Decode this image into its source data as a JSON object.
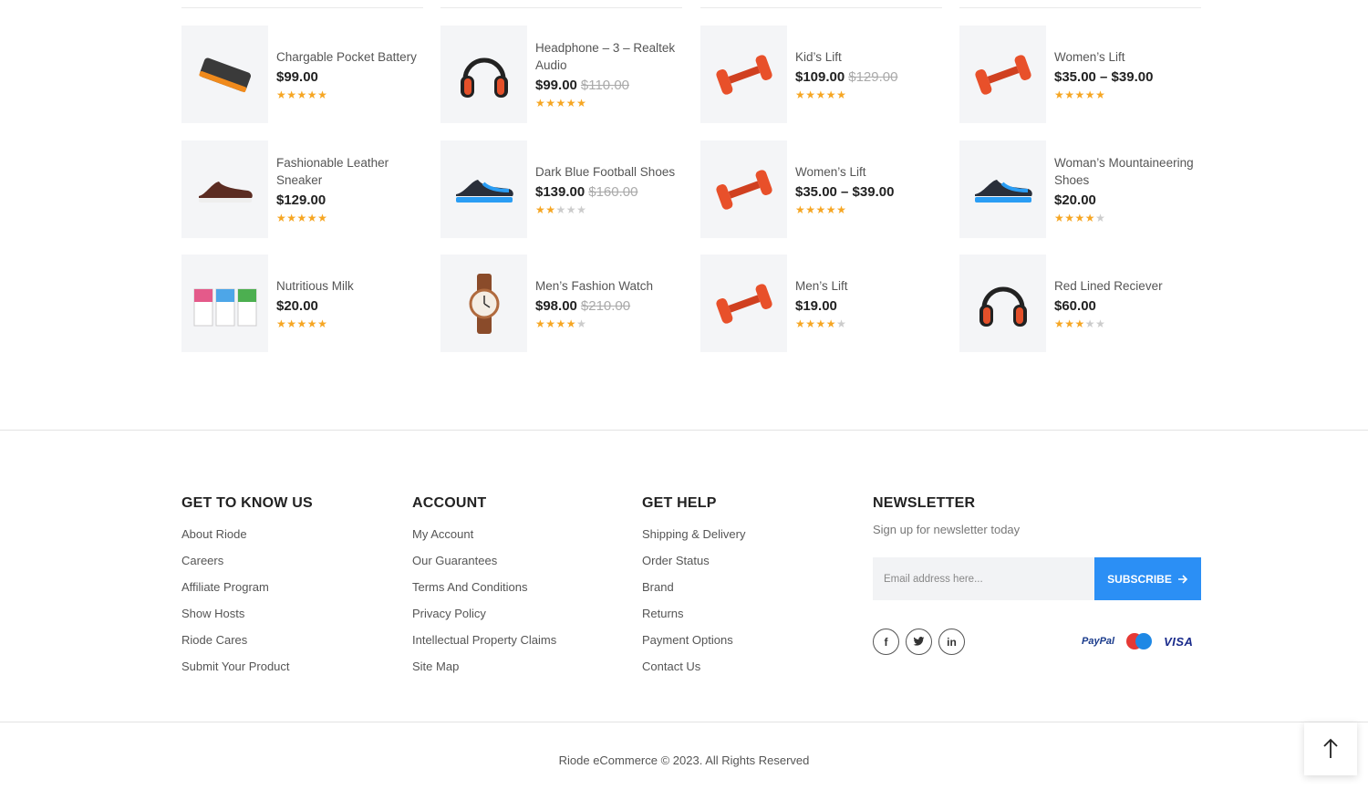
{
  "products": [
    {
      "name": "Chargable Pocket Battery",
      "price": "$99.00",
      "old_price": "",
      "rating": 5,
      "icon": "battery-pack-image"
    },
    {
      "name": "Headphone – 3 – Realtek Audio",
      "price": "$99.00",
      "old_price": "$110.00",
      "rating": 4.5,
      "icon": "headphones-image"
    },
    {
      "name": "Kid’s Lift",
      "price": "$109.00",
      "old_price": "$129.00",
      "rating": 4.5,
      "icon": "dumbbell-image"
    },
    {
      "name": "Women’s Lift",
      "price": "$35.00 – $39.00",
      "old_price": "",
      "rating": 5,
      "icon": "dumbbell-image"
    },
    {
      "name": "Fashionable Leather Sneaker",
      "price": "$129.00",
      "old_price": "",
      "rating": 5,
      "icon": "sneaker-image"
    },
    {
      "name": "Dark Blue Football Shoes",
      "price": "$139.00",
      "old_price": "$160.00",
      "rating": 2,
      "icon": "shoe-image"
    },
    {
      "name": "Women’s Lift",
      "price": "$35.00 – $39.00",
      "old_price": "",
      "rating": 5,
      "icon": "dumbbell-image"
    },
    {
      "name": "Woman’s Mountaineering Shoes",
      "price": "$20.00",
      "old_price": "",
      "rating": 4,
      "icon": "shoe-image"
    },
    {
      "name": "Nutritious Milk",
      "price": "$20.00",
      "old_price": "",
      "rating": 5,
      "icon": "milk-carton-image"
    },
    {
      "name": "Men’s Fashion Watch",
      "price": "$98.00",
      "old_price": "$210.00",
      "rating": 4,
      "icon": "watch-image"
    },
    {
      "name": "Men’s Lift",
      "price": "$19.00",
      "old_price": "",
      "rating": 4,
      "icon": "dumbbell-image"
    },
    {
      "name": "Red Lined Reciever",
      "price": "$60.00",
      "old_price": "",
      "rating": 3,
      "icon": "headphones-image"
    }
  ],
  "footer": {
    "get_to_know": {
      "title": "GET TO KNOW US",
      "links": [
        "About Riode",
        "Careers",
        "Affiliate Program",
        "Show Hosts",
        "Riode Cares",
        "Submit Your Product"
      ]
    },
    "account": {
      "title": "ACCOUNT",
      "links": [
        "My Account",
        "Our Guarantees",
        "Terms And Conditions",
        "Privacy Policy",
        "Intellectual Property Claims",
        "Site Map"
      ]
    },
    "get_help": {
      "title": "GET HELP",
      "links": [
        "Shipping & Delivery",
        "Order Status",
        "Brand",
        "Returns",
        "Payment Options",
        "Contact Us"
      ]
    },
    "newsletter": {
      "title": "NEWSLETTER",
      "text": "Sign up for newsletter today",
      "placeholder": "Email address here...",
      "button": "SUBSCRIBE"
    },
    "socials": [
      "facebook-icon",
      "twitter-icon",
      "linkedin-icon"
    ],
    "payments": {
      "paypal": "PayPal",
      "maestro": "Maestro",
      "visa": "VISA"
    },
    "copyright": "Riode eCommerce © 2023. All Rights Reserved"
  },
  "colors": {
    "accent": "#2b8ff5",
    "star": "#f6a623",
    "star_off": "#cccccc"
  }
}
